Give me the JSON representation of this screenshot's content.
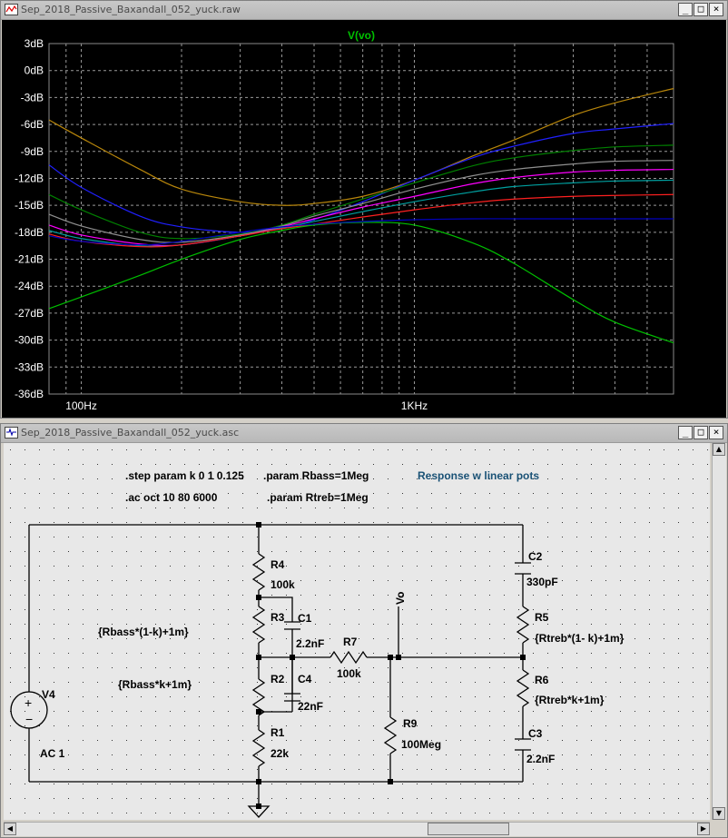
{
  "top_window": {
    "title": "Sep_2018_Passive_Baxandall_052_yuck.raw",
    "buttons": {
      "minimize": "_",
      "maximize": "□",
      "close": "×"
    }
  },
  "bottom_window": {
    "title": "Sep_2018_Passive_Baxandall_052_yuck.asc",
    "buttons": {
      "minimize": "_",
      "maximize": "□",
      "close": "×"
    }
  },
  "chart_data": {
    "type": "line",
    "title": "V(vo)",
    "xlabel": "",
    "ylabel": "",
    "x_scale": "log",
    "xlim": [
      80,
      6000
    ],
    "ylim": [
      -36,
      3
    ],
    "x_tick_labels": [
      "100Hz",
      "1KHz"
    ],
    "y_tick_labels": [
      "3dB",
      "0dB",
      "-3dB",
      "-6dB",
      "-9dB",
      "-12dB",
      "-15dB",
      "-18dB",
      "-21dB",
      "-24dB",
      "-27dB",
      "-30dB",
      "-33dB",
      "-36dB"
    ],
    "grid": true,
    "x": [
      80,
      100,
      150,
      200,
      300,
      400,
      500,
      700,
      1000,
      1500,
      2000,
      3000,
      4000,
      6000
    ],
    "series": [
      {
        "color": "#b8860b",
        "values": [
          -5.5,
          -7.5,
          -11.0,
          -13.2,
          -14.6,
          -15.0,
          -14.8,
          -14.0,
          -12.2,
          -9.5,
          -7.7,
          -5.0,
          -3.6,
          -2.0
        ]
      },
      {
        "color": "#2020ff",
        "values": [
          -10.5,
          -13.0,
          -16.2,
          -17.4,
          -18.0,
          -17.6,
          -16.6,
          -14.6,
          -12.2,
          -9.7,
          -8.4,
          -7.0,
          -6.5,
          -5.9
        ]
      },
      {
        "color": "#008000",
        "values": [
          -13.8,
          -15.5,
          -18.0,
          -18.7,
          -18.2,
          -17.2,
          -16.0,
          -14.3,
          -12.5,
          -10.6,
          -9.7,
          -8.9,
          -8.5,
          -8.3
        ]
      },
      {
        "color": "#909090",
        "values": [
          -16.0,
          -17.3,
          -18.8,
          -19.1,
          -18.3,
          -17.3,
          -16.2,
          -14.8,
          -13.2,
          -11.7,
          -11.0,
          -10.4,
          -10.1,
          -10.0
        ]
      },
      {
        "color": "#ff00ff",
        "values": [
          -17.2,
          -18.3,
          -19.3,
          -19.4,
          -18.4,
          -17.4,
          -16.5,
          -15.2,
          -14.0,
          -12.6,
          -11.9,
          -11.3,
          -11.1,
          -11.0
        ]
      },
      {
        "color": "#00a0a0",
        "values": [
          -17.8,
          -18.7,
          -19.5,
          -19.4,
          -18.4,
          -17.5,
          -16.8,
          -15.7,
          -14.6,
          -13.5,
          -12.9,
          -12.5,
          -12.3,
          -12.2
        ]
      },
      {
        "color": "#ff2020",
        "values": [
          -18.2,
          -19.0,
          -19.6,
          -19.4,
          -18.4,
          -17.6,
          -17.1,
          -16.3,
          -15.5,
          -14.7,
          -14.3,
          -14.0,
          -13.9,
          -13.8
        ]
      },
      {
        "color": "#00c000",
        "values": [
          -26.5,
          -25.2,
          -22.8,
          -21.0,
          -18.8,
          -17.8,
          -17.2,
          -16.9,
          -17.2,
          -19.2,
          -21.5,
          -25.5,
          -28.0,
          -30.3
        ]
      },
      {
        "color": "#0000c0",
        "values": [
          -18.4,
          -19.0,
          -19.4,
          -19.0,
          -18.0,
          -17.4,
          -17.1,
          -16.8,
          -16.6,
          -16.5,
          -16.5,
          -16.5,
          -16.5,
          -16.5
        ]
      }
    ]
  },
  "schematic": {
    "directives": {
      "step": ".step param k 0 1 0.125",
      "param_bass": ".param Rbass=1Meg",
      "comment": "Response w linear pots",
      "ac": ".ac oct 10 80 6000",
      "param_treb": ".param Rtreb=1Meg"
    },
    "labels": {
      "r4": "R4",
      "r4_val": "100k",
      "r3": "R3",
      "r3_val": "{Rbass*(1-k)+1m}",
      "c1": "C1",
      "c1_val": "2.2nF",
      "r7": "R7",
      "r7_val": "100k",
      "r2": "R2",
      "r2_val": "{Rbass*k+1m}",
      "c4": "C4",
      "c4_val": "22nF",
      "r1": "R1",
      "r1_val": "22k",
      "v4": "V4",
      "v4_val": "AC 1",
      "r9": "R9",
      "r9_val": "100Meg",
      "vo": "Vo",
      "c2": "C2",
      "c2_val": "330pF",
      "r5": "R5",
      "r5_val": "{Rtreb*(1- k)+1m}",
      "r6": "R6",
      "r6_val": "{Rtreb*k+1m}",
      "c3": "C3",
      "c3_val": "2.2nF"
    }
  }
}
